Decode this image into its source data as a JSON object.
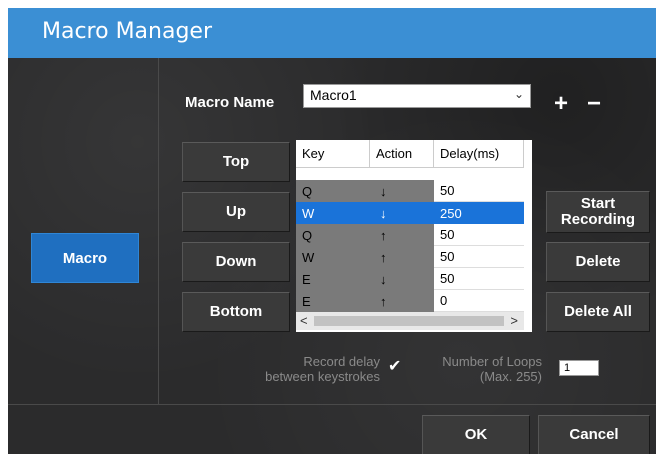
{
  "window": {
    "title": "Macro Manager"
  },
  "sidebar": {
    "tab_label": "Macro"
  },
  "macro_name": {
    "label": "Macro Name",
    "value": "Macro1",
    "add": "+",
    "remove": "−"
  },
  "order_buttons": {
    "top": "Top",
    "up": "Up",
    "down": "Down",
    "bottom": "Bottom"
  },
  "table": {
    "headers": [
      "Key",
      "Action",
      "Delay(ms)"
    ],
    "rows": [
      {
        "key": "Q",
        "action": "↓",
        "delay": "50"
      },
      {
        "key": "W",
        "action": "↓",
        "delay": "250",
        "selected": true
      },
      {
        "key": "Q",
        "action": "↑",
        "delay": "50"
      },
      {
        "key": "W",
        "action": "↑",
        "delay": "50"
      },
      {
        "key": "E",
        "action": "↓",
        "delay": "50"
      },
      {
        "key": "E",
        "action": "↑",
        "delay": "0"
      }
    ],
    "scroll_left": "<",
    "scroll_right": ">"
  },
  "record_buttons": {
    "start_line1": "Start",
    "start_line2": "Recording",
    "delete": "Delete",
    "delete_all": "Delete All"
  },
  "options": {
    "record_delay_line1": "Record delay",
    "record_delay_line2": "between keystrokes",
    "record_delay_checked": true,
    "loops_line1": "Number of Loops",
    "loops_line2": "(Max. 255)",
    "loops_value": "1"
  },
  "footer": {
    "ok": "OK",
    "cancel": "Cancel"
  },
  "colors": {
    "accent": "#3b8fd4",
    "selection": "#1a73d9",
    "background": "#2b2b2c"
  }
}
